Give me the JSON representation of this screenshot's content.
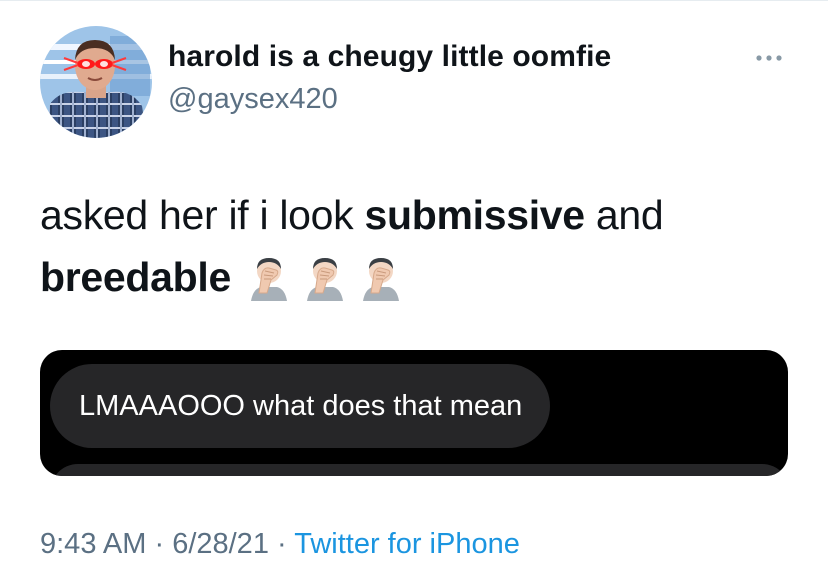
{
  "tweet": {
    "display_name": "harold is a cheugy little oomfie",
    "handle": "@gaysex420",
    "text": {
      "part1": "asked her if i look ",
      "bold1": "submissive",
      "part2": " and ",
      "bold2": "breedable"
    },
    "emoji": [
      "person-facepalming",
      "person-facepalming",
      "person-facepalming"
    ],
    "time": "9:43 AM",
    "separator": " · ",
    "date": "6/28/21",
    "source": "Twitter for iPhone"
  },
  "media": {
    "message_text": "LMAAAOOO what does that mean"
  },
  "colors": {
    "text": "#0f1419",
    "secondary": "#5b7083",
    "link": "#1b95e0",
    "bubble": "#262628"
  }
}
